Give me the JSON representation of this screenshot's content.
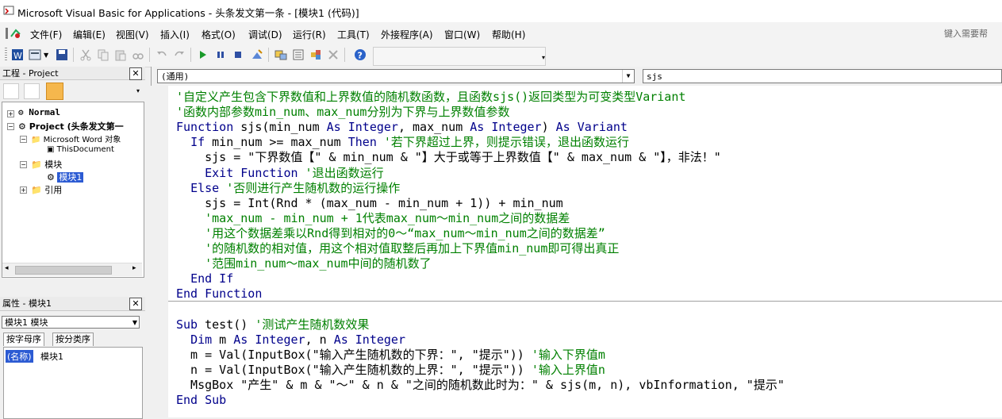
{
  "window": {
    "title": "Microsoft Visual Basic for Applications - 头条发文第一条 - [模块1 (代码)]"
  },
  "menu": [
    "文件(F)",
    "编辑(E)",
    "视图(V)",
    "插入(I)",
    "格式(O)",
    "调试(D)",
    "运行(R)",
    "工具(T)",
    "外接程序(A)",
    "窗口(W)",
    "帮助(H)"
  ],
  "help_box": "键入需要帮",
  "project_pane": {
    "title": "工程 - Project",
    "tree": {
      "normal": "Normal",
      "project": "Project (头条发文第一",
      "word_objects": "Microsoft Word 对象",
      "this_document": "ThisDocument",
      "modules": "模块",
      "module1": "模块1",
      "references": "引用"
    }
  },
  "properties_pane": {
    "title": "属性 - 模块1",
    "object_select": "模块1 模块",
    "tabs": [
      "按字母序",
      "按分类序"
    ],
    "prop_name": "(名称)",
    "prop_value": "模块1"
  },
  "code_window": {
    "object_combo": "(通用)",
    "proc_combo": "sjs",
    "lines": [
      [
        {
          "t": "c",
          "s": "'自定义产生包含下界数值和上界数值的随机数函数，且函数sjs()返回类型为可变类型Variant"
        }
      ],
      [
        {
          "t": "c",
          "s": "'函数内部参数min_num、max_num分别为下界与上界数值参数"
        }
      ],
      [
        {
          "t": "k",
          "s": "Function"
        },
        {
          "t": "t",
          "s": " sjs(min_num "
        },
        {
          "t": "k",
          "s": "As Integer"
        },
        {
          "t": "t",
          "s": ", max_num "
        },
        {
          "t": "k",
          "s": "As Integer"
        },
        {
          "t": "t",
          "s": ") "
        },
        {
          "t": "k",
          "s": "As Variant"
        }
      ],
      [
        {
          "t": "t",
          "s": "  "
        },
        {
          "t": "k",
          "s": "If"
        },
        {
          "t": "t",
          "s": " min_num >= max_num "
        },
        {
          "t": "k",
          "s": "Then"
        },
        {
          "t": "c",
          "s": " '若下界超过上界，则提示错误，退出函数运行"
        }
      ],
      [
        {
          "t": "t",
          "s": "    sjs = \"下界数值【\" & min_num & \"】大于或等于上界数值【\" & max_num & \"】，非法！\""
        }
      ],
      [
        {
          "t": "t",
          "s": "    "
        },
        {
          "t": "k",
          "s": "Exit Function"
        },
        {
          "t": "c",
          "s": " '退出函数运行"
        }
      ],
      [
        {
          "t": "t",
          "s": "  "
        },
        {
          "t": "k",
          "s": "Else"
        },
        {
          "t": "c",
          "s": " '否则进行产生随机数的运行操作"
        }
      ],
      [
        {
          "t": "t",
          "s": "    sjs = Int(Rnd * (max_num - min_num + 1)) + min_num"
        }
      ],
      [
        {
          "t": "c",
          "s": "    'max_num - min_num + 1代表max_num～min_num之间的数据差"
        }
      ],
      [
        {
          "t": "c",
          "s": "    '用这个数据差乘以Rnd得到相对的0～“max_num～min_num之间的数据差”"
        }
      ],
      [
        {
          "t": "c",
          "s": "    '的随机数的相对值，用这个相对值取整后再加上下界值min_num即可得出真正"
        }
      ],
      [
        {
          "t": "c",
          "s": "    '范围min_num～max_num中间的随机数了"
        }
      ],
      [
        {
          "t": "t",
          "s": "  "
        },
        {
          "t": "k",
          "s": "End If"
        }
      ],
      [
        {
          "t": "k",
          "s": "End Function"
        }
      ],
      [
        {
          "t": "t",
          "s": ""
        }
      ],
      [
        {
          "t": "k",
          "s": "Sub"
        },
        {
          "t": "t",
          "s": " test()"
        },
        {
          "t": "c",
          "s": " '测试产生随机数效果"
        }
      ],
      [
        {
          "t": "t",
          "s": "  "
        },
        {
          "t": "k",
          "s": "Dim"
        },
        {
          "t": "t",
          "s": " m "
        },
        {
          "t": "k",
          "s": "As Integer"
        },
        {
          "t": "t",
          "s": ", n "
        },
        {
          "t": "k",
          "s": "As Integer"
        }
      ],
      [
        {
          "t": "t",
          "s": "  m = Val(InputBox(\"输入产生随机数的下界：\", \"提示\"))"
        },
        {
          "t": "c",
          "s": " '输入下界值m"
        }
      ],
      [
        {
          "t": "t",
          "s": "  n = Val(InputBox(\"输入产生随机数的上界：\", \"提示\"))"
        },
        {
          "t": "c",
          "s": " '输入上界值n"
        }
      ],
      [
        {
          "t": "t",
          "s": "  MsgBox \"产生\" & m & \"～\" & n & \"之间的随机数此时为：\" & sjs(m, n), vbInformation, \"提示\""
        }
      ],
      [
        {
          "t": "k",
          "s": "End Sub"
        }
      ]
    ]
  }
}
